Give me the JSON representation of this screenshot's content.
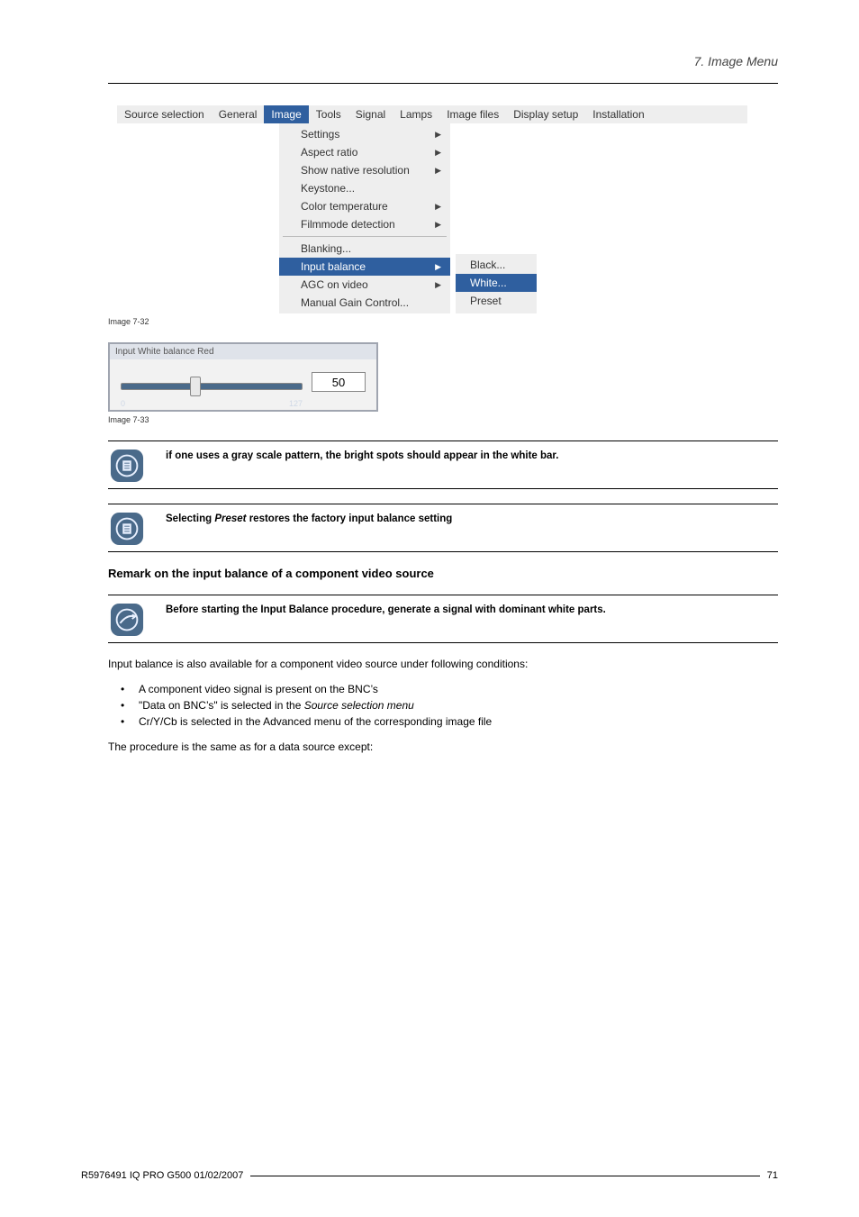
{
  "header": {
    "chapter": "7.  Image Menu"
  },
  "menubar": {
    "tabs": [
      "Source selection",
      "General",
      "Image",
      "Tools",
      "Signal",
      "Lamps",
      "Image files",
      "Display setup",
      "Installation"
    ],
    "active_index": 2
  },
  "image_menu": {
    "items": [
      {
        "label": "Settings",
        "arrow": true,
        "highlight": false
      },
      {
        "label": "Aspect ratio",
        "arrow": true,
        "highlight": false
      },
      {
        "label": "Show native resolution",
        "arrow": true,
        "highlight": false
      },
      {
        "label": "Keystone...",
        "arrow": false,
        "highlight": false
      },
      {
        "label": "Color temperature",
        "arrow": true,
        "highlight": false
      },
      {
        "label": "Filmmode detection",
        "arrow": true,
        "highlight": false
      },
      {
        "sep": true
      },
      {
        "label": "Blanking...",
        "arrow": false,
        "highlight": false
      },
      {
        "label": "Input balance",
        "arrow": true,
        "highlight": true
      },
      {
        "label": "AGC on video",
        "arrow": true,
        "highlight": false
      },
      {
        "label": "Manual Gain Control...",
        "arrow": false,
        "highlight": false
      }
    ],
    "submenu": [
      {
        "label": "Black...",
        "highlight": false
      },
      {
        "label": "White...",
        "highlight": true
      },
      {
        "label": "Preset",
        "highlight": false
      }
    ]
  },
  "captions": {
    "img1": "Image 7-32",
    "img2": "Image 7-33"
  },
  "slider": {
    "title": "Input White balance Red",
    "min": "0",
    "max": "127",
    "value": "50"
  },
  "notes": {
    "n1": "if one uses a gray scale pattern, the bright spots should appear in the white bar.",
    "n2_pre": "Selecting ",
    "n2_em": "Preset",
    "n2_post": " restores the factory input balance setting",
    "n3": "Before starting the Input Balance procedure, generate a signal with dominant white parts."
  },
  "section": {
    "heading": "Remark on the input balance of a component video source",
    "intro": "Input balance is also available for a component video source under following conditions:",
    "bullets": [
      {
        "text": "A component video signal is present on the BNC’s"
      },
      {
        "pre": "\"Data on BNC’s\" is selected in the ",
        "em": "Source selection menu"
      },
      {
        "text": "Cr/Y/Cb is selected in the Advanced menu of the corresponding image file"
      }
    ],
    "outro": "The procedure is the same as for a data source except:"
  },
  "footer": {
    "doc": "R5976491  IQ PRO G500  01/02/2007",
    "page": "71"
  }
}
